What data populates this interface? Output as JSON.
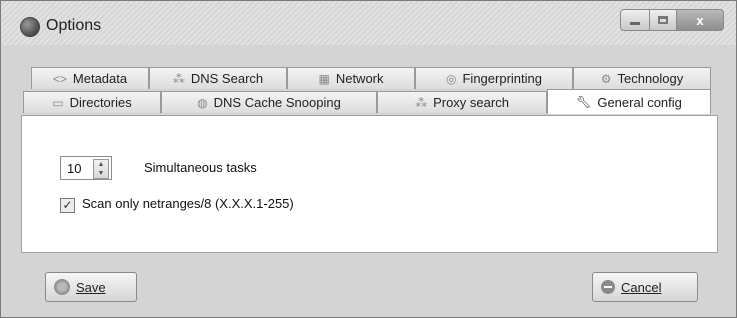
{
  "window": {
    "title": "Options",
    "close_glyph": "x"
  },
  "tabs_row1": [
    {
      "label": "Metadata",
      "icon": "code-icon"
    },
    {
      "label": "DNS Search",
      "icon": "network-nodes-icon"
    },
    {
      "label": "Network",
      "icon": "network-icon"
    },
    {
      "label": "Fingerprinting",
      "icon": "fingerprint-icon"
    },
    {
      "label": "Technology",
      "icon": "gear-icon"
    }
  ],
  "tabs_row2": [
    {
      "label": "Directories",
      "icon": "folder-icon"
    },
    {
      "label": "DNS Cache Snooping",
      "icon": "snoop-icon"
    },
    {
      "label": "Proxy search",
      "icon": "network-nodes-icon"
    },
    {
      "label": "General config",
      "icon": "wrench-icon",
      "active": true
    }
  ],
  "general_config": {
    "simultaneous_tasks_value": "10",
    "simultaneous_tasks_label": "Simultaneous tasks",
    "scan_netranges_checked": true,
    "scan_netranges_label": "Scan only netranges/8 (X.X.X.1-255)"
  },
  "buttons": {
    "save_label": "Save",
    "cancel_label": "Cancel"
  }
}
